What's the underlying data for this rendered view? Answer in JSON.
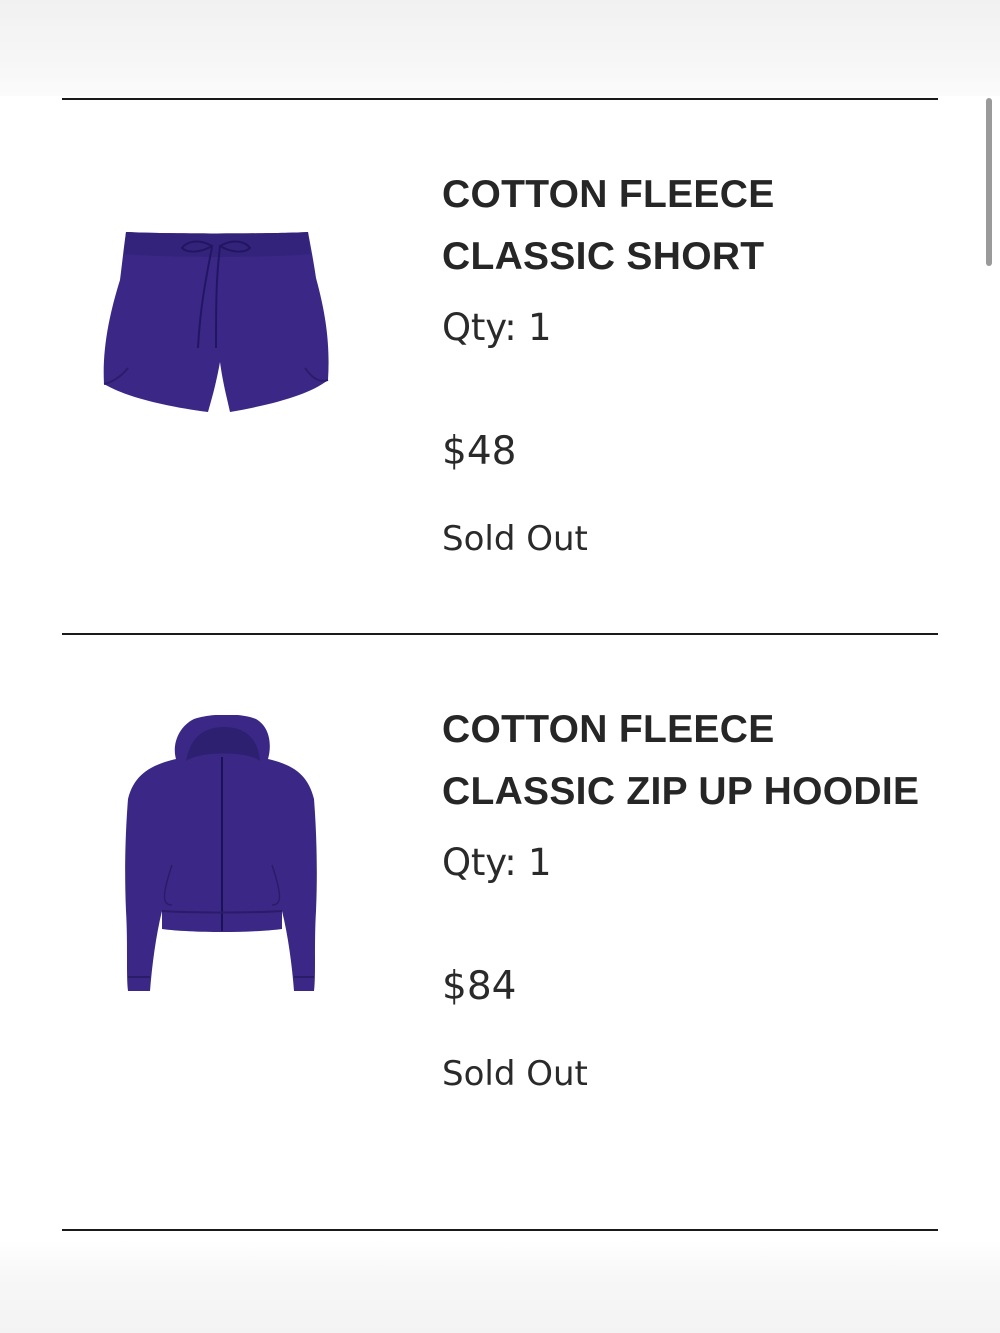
{
  "cart": {
    "items": [
      {
        "name": "COTTON FLEECE CLASSIC SHORT",
        "qty_label": "Qty: 1",
        "price": "$48",
        "status": "Sold Out",
        "image_icon": "shorts-product-image",
        "color": "#3b2886"
      },
      {
        "name": "COTTON FLEECE CLASSIC ZIP UP HOODIE",
        "qty_label": "Qty: 1",
        "price": "$84",
        "status": "Sold Out",
        "image_icon": "zip-hoodie-product-image",
        "color": "#3b2886"
      }
    ]
  }
}
